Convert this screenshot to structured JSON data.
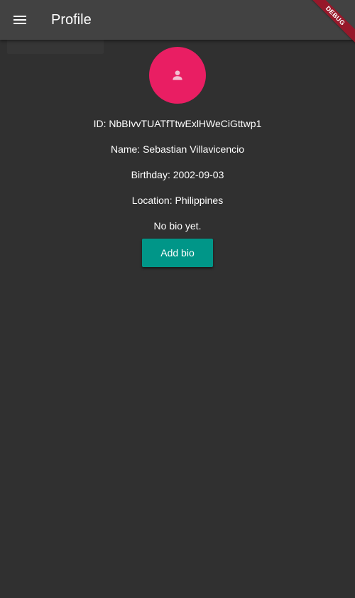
{
  "app_bar": {
    "title": "Profile",
    "menu_icon": "menu-icon",
    "debug_banner": "DEBUG",
    "debug_banner_color": "#a01428"
  },
  "profile": {
    "avatar_icon": "person-icon",
    "avatar_color": "#e91e63",
    "id_line": "ID: NbBIvvTUATfTtwExlHWeCiGttwp1",
    "name_line": "Name: Sebastian Villavicencio",
    "birthday_line": "Birthday: 2002-09-03",
    "location_line": "Location: Philippines",
    "bio_line": "No bio yet.",
    "add_bio_label": "Add bio",
    "add_bio_color": "#009688"
  },
  "theme": {
    "background": "#303030",
    "app_bar": "#424242",
    "text": "#ffffff"
  }
}
